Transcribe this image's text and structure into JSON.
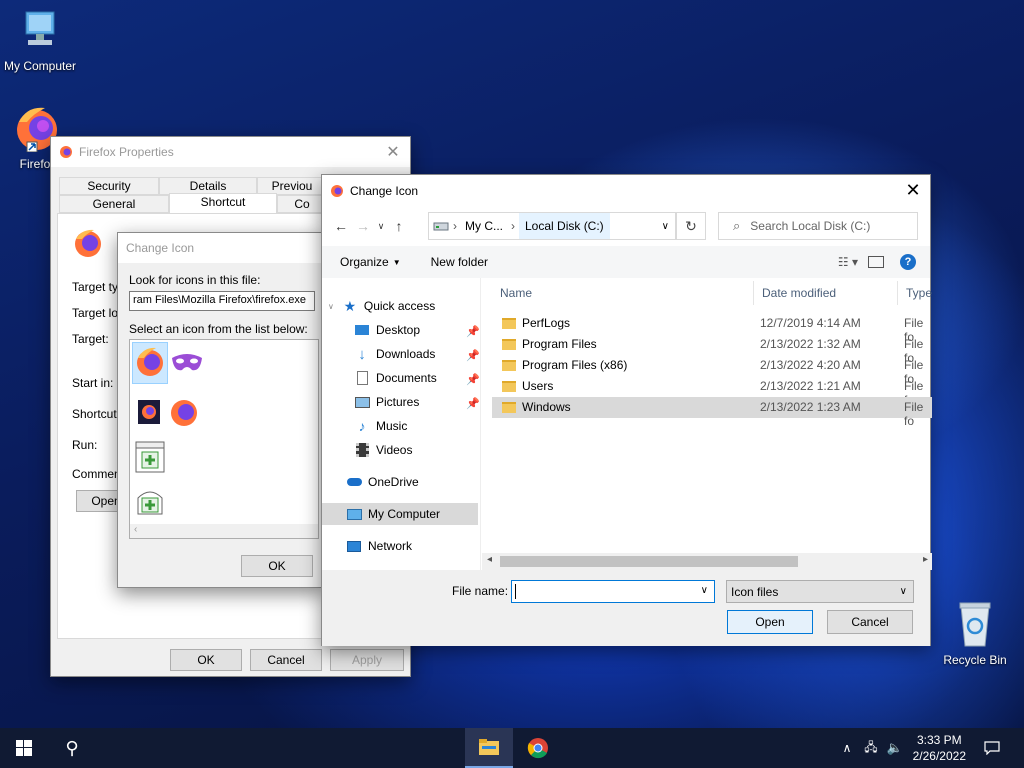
{
  "desktop": {
    "icons": [
      {
        "label": "My Computer"
      },
      {
        "label": "Firefox"
      },
      {
        "label": "Recycle Bin"
      }
    ]
  },
  "props": {
    "title": "Firefox Properties",
    "tabs_row1": [
      "Security",
      "Details",
      "Previou"
    ],
    "tabs_row2": [
      "General",
      "Shortcut",
      "Co"
    ],
    "fields": [
      "Target typ",
      "Target loc",
      "Target:",
      "Start in:",
      "Shortcut k",
      "Run:",
      "Comment:"
    ],
    "open_label": "Open",
    "ok": "OK",
    "cancel": "Cancel",
    "apply": "Apply"
  },
  "change_icon_small": {
    "title": "Change Icon",
    "look_label": "Look for icons in this file:",
    "path_value": "ram Files\\Mozilla Firefox\\firefox.exe",
    "select_label": "Select an icon from the list below:",
    "ok": "OK"
  },
  "dialog": {
    "title": "Change Icon",
    "breadcrumb": [
      "My C...",
      "Local Disk (C:)"
    ],
    "search_placeholder": "Search Local Disk (C:)",
    "organize": "Organize",
    "new_folder": "New folder",
    "nav": {
      "quick_access": "Quick access",
      "items": [
        {
          "label": "Desktop",
          "pinned": true
        },
        {
          "label": "Downloads",
          "pinned": true
        },
        {
          "label": "Documents",
          "pinned": true
        },
        {
          "label": "Pictures",
          "pinned": true
        },
        {
          "label": "Music",
          "pinned": false
        },
        {
          "label": "Videos",
          "pinned": false
        }
      ],
      "onedrive": "OneDrive",
      "my_computer": "My Computer",
      "network": "Network"
    },
    "columns": [
      "Name",
      "Date modified",
      "Type"
    ],
    "files": [
      {
        "name": "PerfLogs",
        "date": "12/7/2019 4:14 AM",
        "type": "File fo"
      },
      {
        "name": "Program Files",
        "date": "2/13/2022 1:32 AM",
        "type": "File fo"
      },
      {
        "name": "Program Files (x86)",
        "date": "2/13/2022 4:20 AM",
        "type": "File fo"
      },
      {
        "name": "Users",
        "date": "2/13/2022 1:21 AM",
        "type": "File fo"
      },
      {
        "name": "Windows",
        "date": "2/13/2022 1:23 AM",
        "type": "File fo"
      }
    ],
    "file_name_label": "File name:",
    "file_name_value": "",
    "file_type": "Icon files",
    "open": "Open",
    "cancel": "Cancel"
  },
  "taskbar": {
    "time": "3:33 PM",
    "date": "2/26/2022"
  }
}
